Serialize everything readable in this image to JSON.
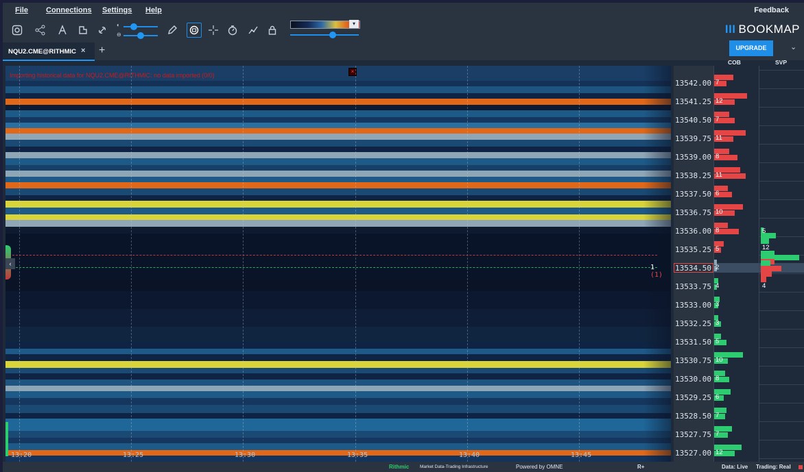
{
  "menu": {
    "file": "File",
    "connections": "Connections",
    "settings": "Settings",
    "help": "Help",
    "feedback": "Feedback"
  },
  "brand": {
    "logo_text": "BOOKMAP",
    "bars": "III"
  },
  "tab": {
    "label": "NQU2.CME@RITHMIC",
    "close": "×",
    "add": "+"
  },
  "upgrade_label": "UPGRADE",
  "columns": {
    "cob": "COB",
    "svp": "SVP"
  },
  "warning_text": "Importing historical data for NQU2.CME@RITHMIC: no data imported (0/0)",
  "warning_close": "×",
  "prices": [
    "13542.00",
    "13541.25",
    "13540.50",
    "13539.75",
    "13539.00",
    "13538.25",
    "13537.50",
    "13536.75",
    "13536.00",
    "13535.25",
    "13534.50",
    "13533.75",
    "13533.00",
    "13532.25",
    "13531.50",
    "13530.75",
    "13530.00",
    "13529.25",
    "13528.50",
    "13527.75",
    "13527.00"
  ],
  "current_price": {
    "value": "13534.50",
    "label_a": "1",
    "label_b": "(1)"
  },
  "cob_counts": [
    "7",
    "12",
    "7",
    "11",
    "8",
    "11",
    "6",
    "10",
    "8",
    "5",
    "2",
    "4",
    "3",
    "3",
    "5",
    "10",
    "8",
    "6",
    "7",
    "7",
    "12"
  ],
  "svp_counts": [
    "5",
    "12",
    "4"
  ],
  "time_labels": [
    "13:20",
    "13:25",
    "13:30",
    "13:35",
    "13:40",
    "13:45"
  ],
  "status": {
    "rithmic": "Rithmic",
    "rithmic_sub": "Market Data-Trading Infrastructure",
    "powered": "Powered by OMNE",
    "rplus": "R+",
    "data": "Data: Live",
    "trading": "Trading: Real"
  },
  "colors": {
    "accent": "#2196f3",
    "bid": "#2ecc71",
    "ask": "#e64545",
    "orange": "#e06818",
    "yellow": "#d9d43a"
  }
}
